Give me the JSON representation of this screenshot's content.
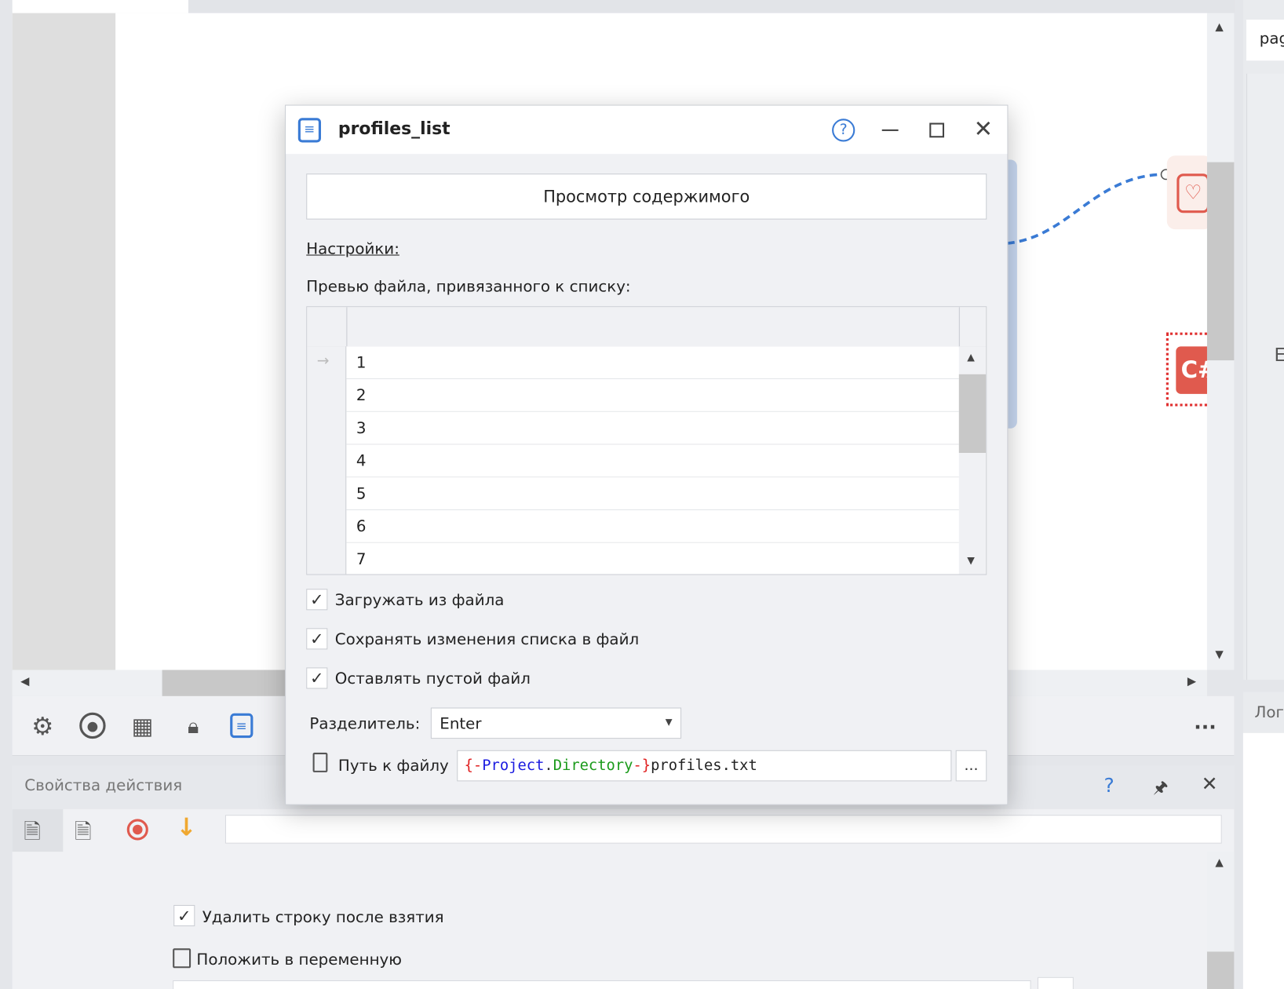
{
  "colors": {
    "accent": "#3a7bd5",
    "danger": "#e05a4e",
    "warning": "#f0a830"
  },
  "side_panel": {
    "top_text": "pag",
    "mid_text": "Е",
    "log_tab": "Лог"
  },
  "canvas": {
    "csharp_node_label": "C#"
  },
  "toolbar": {
    "more_label": "..."
  },
  "properties": {
    "title": "Свойства действия",
    "help_label": "?",
    "delete_line_label": "Удалить строку после взятия",
    "delete_line_checked": true,
    "save_to_variable_label": "Положить в переменную",
    "top_input_value": ""
  },
  "dialog": {
    "title": "profiles_list",
    "view_contents_button": "Просмотр содержимого",
    "settings_link": "Настройки:",
    "preview_label": "Превью файла, привязанного к списку:",
    "rows": [
      "1",
      "2",
      "3",
      "4",
      "5",
      "6",
      "7"
    ],
    "options": [
      {
        "label": "Загружать из файла",
        "checked": true
      },
      {
        "label": "Сохранять изменения списка в файл",
        "checked": true
      },
      {
        "label": "Оставлять пустой файл",
        "checked": true
      }
    ],
    "separator_label": "Разделитель:",
    "separator_value": "Enter",
    "path_label": "Путь к файлу",
    "path_parts": {
      "open": "{-",
      "project": "Project",
      "dot": ".",
      "directory": "Directory",
      "close": "-}",
      "file": "profiles.txt"
    },
    "browse_label": "..."
  }
}
